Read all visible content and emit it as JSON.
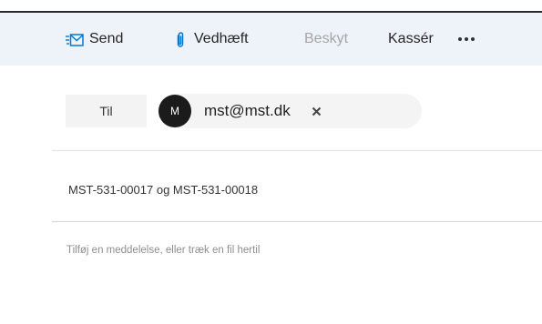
{
  "toolbar": {
    "send_label": "Send",
    "attach_label": "Vedhæft",
    "protect_label": "Beskyt",
    "discard_label": "Kassér",
    "send_icon": "send-envelope-icon",
    "attach_icon": "paperclip-icon",
    "more_icon": "more-options-icon"
  },
  "recipients": {
    "to_label": "Til",
    "items": [
      {
        "avatar_initial": "M",
        "email": "mst@mst.dk",
        "remove_icon": "close-icon"
      }
    ]
  },
  "subject": {
    "value": "MST-531-00017 og MST-531-00018"
  },
  "body": {
    "placeholder": "Tilføj en meddelelse, eller træk en fil hertil"
  },
  "colors": {
    "toolbar_bg": "#eef3f9",
    "accent": "#0078d4",
    "disabled_text": "#a6a6a6",
    "avatar_bg": "#1b1b1b"
  }
}
